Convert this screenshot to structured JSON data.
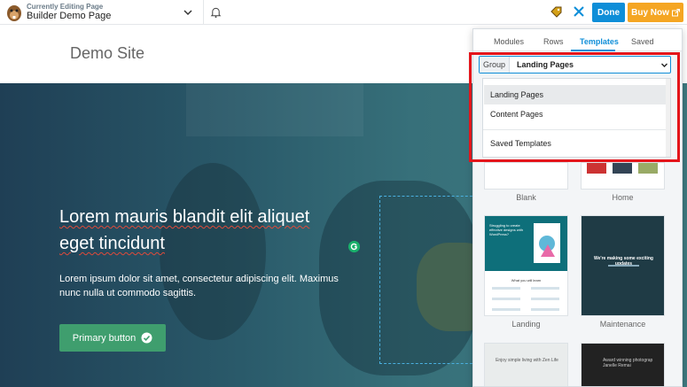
{
  "topbar": {
    "editing_label": "Currently Editing Page",
    "page_name": "Builder Demo Page",
    "done_label": "Done",
    "buy_label": "Buy Now"
  },
  "site": {
    "title": "Demo Site"
  },
  "hero": {
    "heading_line1": "Lorem mauris blandit elit aliquet",
    "heading_line2": "eget tincidunt",
    "text": "Lorem ipsum dolor sit amet, consectetur adipiscing elit. Maximus nunc nulla ut commodo sagittis.",
    "button_label": "Primary button"
  },
  "panel": {
    "tabs": [
      {
        "label": "Modules"
      },
      {
        "label": "Rows"
      },
      {
        "label": "Templates"
      },
      {
        "label": "Saved"
      }
    ],
    "active_tab": "Templates",
    "group_label": "Group",
    "group_value": "Landing Pages",
    "dropdown_options": [
      {
        "label": "Landing Pages",
        "selected": true
      },
      {
        "label": "Content Pages",
        "selected": false
      },
      {
        "label": "Saved Templates",
        "selected": false
      }
    ],
    "templates": [
      {
        "label": "Blank"
      },
      {
        "label": "Home"
      },
      {
        "label": "Landing"
      },
      {
        "label": "Maintenance"
      }
    ],
    "thumb_text": {
      "landing_headline": "Struggling to create effective designs with WordPress?",
      "maintenance_headline": "We're making some exciting updates",
      "landing_sub": "What you will learn",
      "next_left": "Enjoy simple living with Zen Life",
      "next_right": "Award winning photograp Janelle Remai"
    }
  },
  "colors": {
    "accent": "#0e8ed8",
    "buy": "#f5a623",
    "primary_button": "#3f9e6e",
    "highlight": "#e4151b"
  }
}
